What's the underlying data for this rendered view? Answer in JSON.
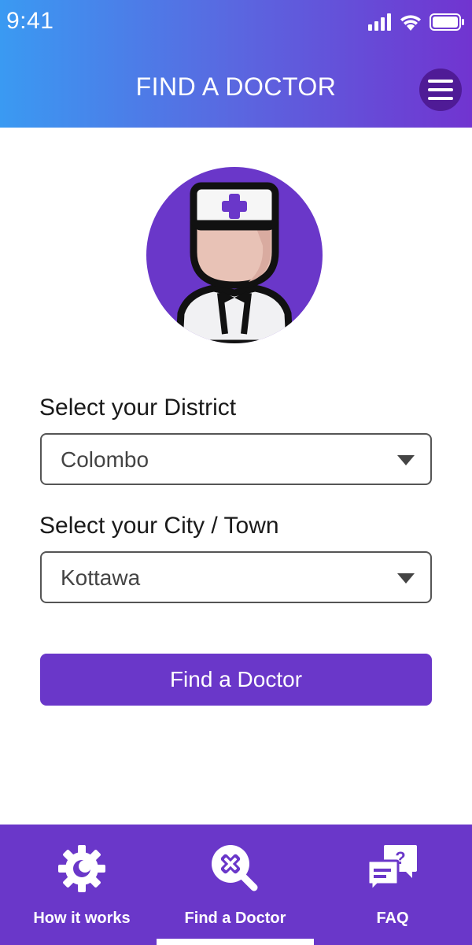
{
  "status_bar": {
    "time": "9:41"
  },
  "header": {
    "title": "FIND A DOCTOR"
  },
  "form": {
    "district_label": "Select your District",
    "district_value": "Colombo",
    "city_label": "Select your City / Town",
    "city_value": "Kottawa",
    "submit_label": "Find a Doctor"
  },
  "bottom_nav": {
    "items": [
      {
        "label": "How it works",
        "icon": "gear-icon"
      },
      {
        "label": "Find a Doctor",
        "icon": "search-doctor-icon",
        "active": true
      },
      {
        "label": "FAQ",
        "icon": "faq-chat-icon"
      }
    ]
  },
  "colors": {
    "header_gradient_start": "#3a9af2",
    "header_gradient_end": "#7134d0",
    "accent": "#6a37c9",
    "menu_button": "#4f1b96"
  }
}
